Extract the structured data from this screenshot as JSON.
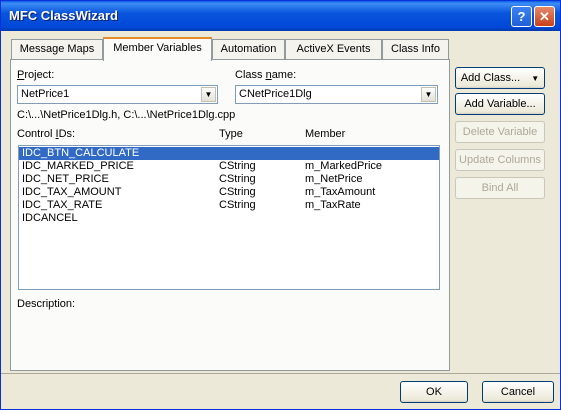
{
  "window": {
    "title": "MFC ClassWizard"
  },
  "title_buttons": {
    "help": "?",
    "close": "✕"
  },
  "tabs": [
    "Message Maps",
    "Member Variables",
    "Automation",
    "ActiveX Events",
    "Class Info"
  ],
  "active_tab": "Member Variables",
  "project": {
    "label_pre": "",
    "label_u": "P",
    "label_post": "roject:",
    "value": "NetPrice1"
  },
  "class_name": {
    "label_pre": "Class ",
    "label_u": "n",
    "label_post": "ame:",
    "value": "CNetPrice1Dlg"
  },
  "files": "C:\\...\\NetPrice1Dlg.h, C:\\...\\NetPrice1Dlg.cpp",
  "columns": {
    "id_pre": "Control ",
    "id_u": "I",
    "id_post": "Ds:",
    "type": "Type",
    "member": "Member"
  },
  "rows": [
    {
      "id": "IDC_BTN_CALCULATE",
      "type": "",
      "member": "",
      "selected": true
    },
    {
      "id": "IDC_MARKED_PRICE",
      "type": "CString",
      "member": "m_MarkedPrice"
    },
    {
      "id": "IDC_NET_PRICE",
      "type": "CString",
      "member": "m_NetPrice"
    },
    {
      "id": "IDC_TAX_AMOUNT",
      "type": "CString",
      "member": "m_TaxAmount"
    },
    {
      "id": "IDC_TAX_RATE",
      "type": "CString",
      "member": "m_TaxRate"
    },
    {
      "id": "IDCANCEL",
      "type": "",
      "member": ""
    }
  ],
  "description_label": "Description:",
  "buttons": {
    "add_class": "Add Class...",
    "add_class_arrow": "▼",
    "add_variable": "Add Variable...",
    "delete_variable": "Delete Variable",
    "update_columns": "Update Columns",
    "bind_all": "Bind All",
    "ok": "OK",
    "cancel": "Cancel"
  },
  "combo_arrow": "▼"
}
